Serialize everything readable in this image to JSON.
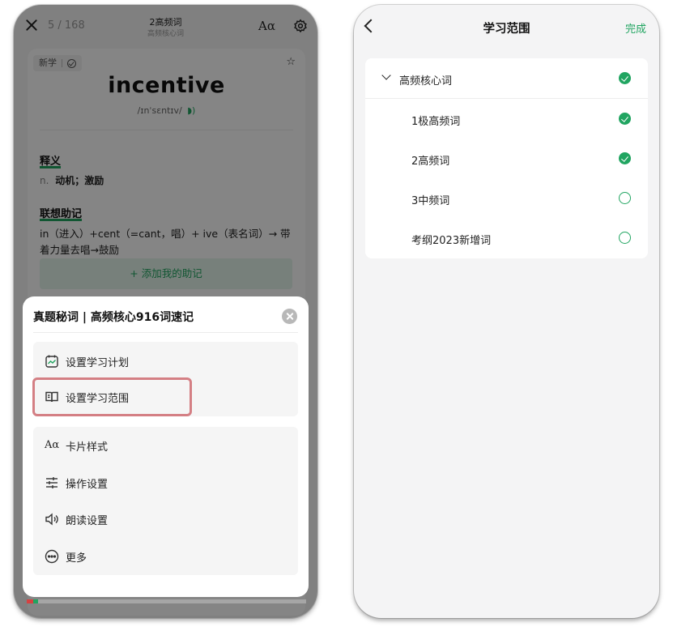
{
  "left_screen": {
    "header": {
      "counter": "5 / 168",
      "deck_title": "2高频词",
      "deck_subtitle": "高频核心词",
      "font_button": "Aα"
    },
    "card": {
      "tag_label": "新学",
      "word": "incentive",
      "phonetic": "/ɪnˈsɛntɪv/",
      "definition_title": "释义",
      "definition_pos": "n.",
      "definition_text": "动机；激励",
      "mnemonic_title": "联想助记",
      "mnemonic_text": "in（进入）+cent（=cant，唱）+ ive（表名词）→ 带着力量去唱→鼓励",
      "add_mnemonic": "+ 添加我的助记"
    },
    "progress": {
      "red_fraction": 0.023,
      "green_fraction": 0.017
    },
    "sheet": {
      "title": "真题秘词 | 高频核心916词速记",
      "group1": [
        {
          "label": "设置学习计划",
          "icon": "calendar-chart-icon"
        },
        {
          "label": "设置学习范围",
          "icon": "book-range-icon"
        }
      ],
      "group2": [
        {
          "label": "卡片样式",
          "icon": "font-aa-icon"
        },
        {
          "label": "操作设置",
          "icon": "sliders-icon"
        },
        {
          "label": "朗读设置",
          "icon": "speaker-icon"
        },
        {
          "label": "更多",
          "icon": "more-dots-icon"
        }
      ]
    }
  },
  "right_screen": {
    "title": "学习范围",
    "done": "完成",
    "parent": {
      "label": "高频核心词",
      "checked": true
    },
    "children": [
      {
        "label": "1极高频词",
        "checked": true
      },
      {
        "label": "2高频词",
        "checked": true
      },
      {
        "label": "3中频词",
        "checked": false
      },
      {
        "label": "考纲2023新增词",
        "checked": false
      }
    ]
  },
  "colors": {
    "accent_green": "#21a561",
    "highlight_border": "#d47f84",
    "progress_red": "#d64141"
  }
}
